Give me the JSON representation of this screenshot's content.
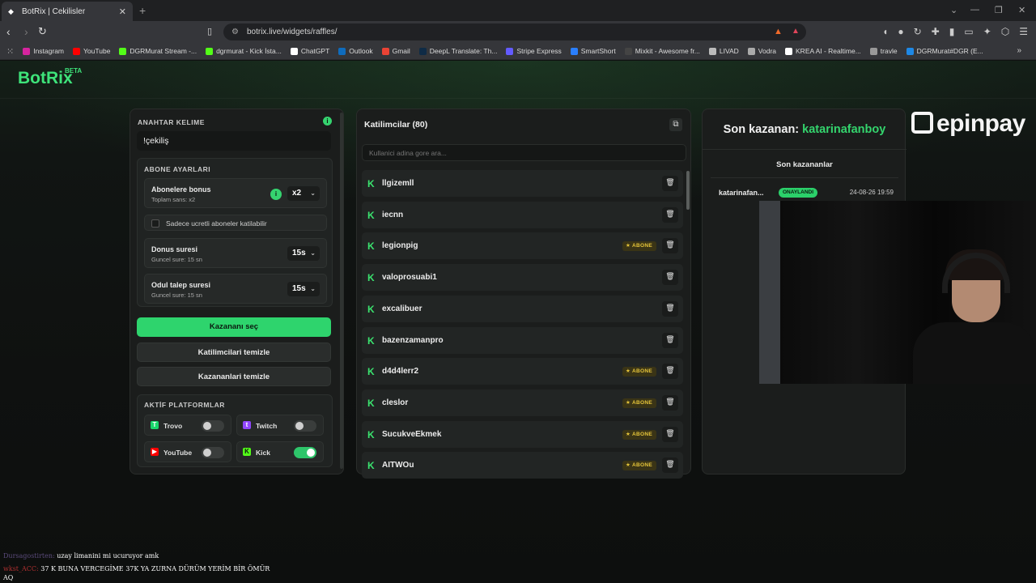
{
  "browser": {
    "tab_title": "BotRix | Cekilisler",
    "url": "botrix.live/widgets/raffles/",
    "bookmarks": [
      {
        "label": "Instagram",
        "color": "#d6249f"
      },
      {
        "label": "YouTube",
        "color": "#ff0000"
      },
      {
        "label": "DGRMurat Stream -...",
        "color": "#53fc18"
      },
      {
        "label": "dgrmurat - Kick İsta...",
        "color": "#53fc18"
      },
      {
        "label": "ChatGPT",
        "color": "#ffffff"
      },
      {
        "label": "Outlook",
        "color": "#0f6cbd"
      },
      {
        "label": "Gmail",
        "color": "#ea4335"
      },
      {
        "label": "DeepL Translate: Th...",
        "color": "#0f2b46"
      },
      {
        "label": "Stripe Express",
        "color": "#635bff"
      },
      {
        "label": "SmartShort",
        "color": "#2a7fff"
      },
      {
        "label": "Mixkit - Awesome fr...",
        "color": "#444444"
      },
      {
        "label": "LIVAD",
        "color": "#bbbbbb"
      },
      {
        "label": "Vodra",
        "color": "#aaaaaa"
      },
      {
        "label": "KREA AI - Realtime...",
        "color": "#ffffff"
      },
      {
        "label": "travle",
        "color": "#999999"
      },
      {
        "label": "DGRMurat#DGR (E...",
        "color": "#1e88e5"
      }
    ]
  },
  "app": {
    "logo": "BotRix",
    "beta": "BETA"
  },
  "settings": {
    "keyword_label": "ANAHTAR KELIME",
    "keyword_value": "!çekiliş",
    "sub_section_label": "ABONE AYARLARI",
    "bonus_title": "Abonelere bonus",
    "bonus_sub": "Toplam sans: x2",
    "bonus_value": "x2",
    "paid_only_label": "Sadece ucretli aboneler katilabilir",
    "bonus_time_title": "Donus suresi",
    "bonus_time_sub": "Guncel sure: 15 sn",
    "bonus_time_value": "15s",
    "claim_time_title": "Odul talep suresi",
    "claim_time_sub": "Guncel sure: 15 sn",
    "claim_time_value": "15s",
    "pick_winner": "Kazananı seç",
    "clear_participants": "Katilimcilari temizle",
    "clear_winners": "Kazananlari temizle",
    "platforms_label": "AKTİF PLATFORMLAR",
    "platforms": [
      {
        "name": "Trovo",
        "on": false,
        "color": "#19d66b",
        "glyph": "T"
      },
      {
        "name": "Twitch",
        "on": false,
        "color": "#9146ff",
        "glyph": "t"
      },
      {
        "name": "YouTube",
        "on": false,
        "color": "#ff0000",
        "glyph": "▶"
      },
      {
        "name": "Kick",
        "on": true,
        "color": "#53fc18",
        "glyph": "K"
      }
    ]
  },
  "participants": {
    "title": "Katilimcilar (80)",
    "search_placeholder": "Kullanici adina gore ara...",
    "badge_label": "ABONE",
    "list": [
      {
        "name": "llgizemll",
        "sub": false
      },
      {
        "name": "iecnn",
        "sub": false
      },
      {
        "name": "legionpig",
        "sub": true
      },
      {
        "name": "valoprosuabi1",
        "sub": false
      },
      {
        "name": "excalibuer",
        "sub": false
      },
      {
        "name": "bazenzamanpro",
        "sub": false
      },
      {
        "name": "d4d4lerr2",
        "sub": true
      },
      {
        "name": "cleslor",
        "sub": true
      },
      {
        "name": "SucukveEkmek",
        "sub": true
      },
      {
        "name": "AITWOu",
        "sub": true
      }
    ]
  },
  "winners": {
    "title_prefix": "Son kazanan:",
    "last_winner": "katarinafanboy",
    "list_title": "Son kazananlar",
    "rows": [
      {
        "name": "katarinafan...",
        "status": "ONAYLANDI",
        "date": "24-08-26 19:59"
      }
    ]
  },
  "sponsor": {
    "text": "epinpay"
  },
  "chat": [
    {
      "user": "Dursagostirten:",
      "msg": "uzay limanini mi ucuruyor amk"
    },
    {
      "user": "wkst_ACC:",
      "msg": "37 K BUNA VERCEGİME 37K YA ZURNA DÜRÜM YERİM BİR ÖMÜR AQ"
    }
  ]
}
